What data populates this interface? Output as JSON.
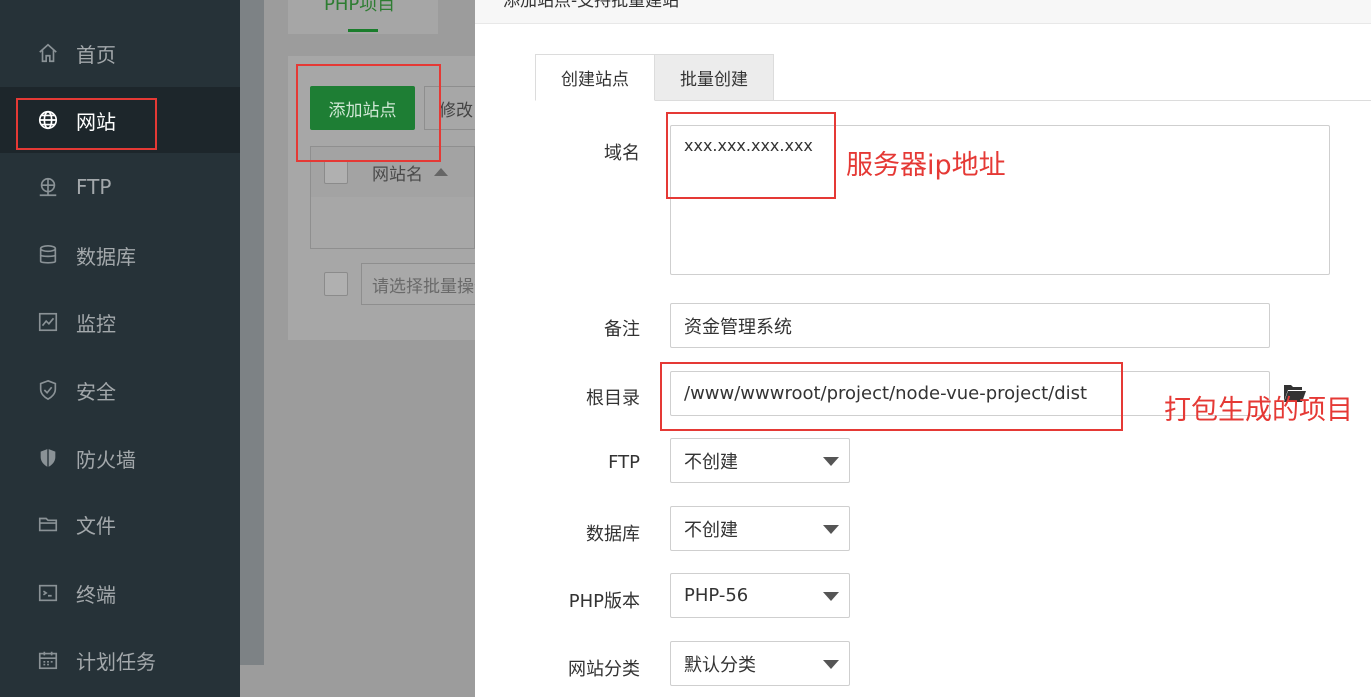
{
  "sidebar": {
    "items": [
      {
        "label": "首页",
        "icon": "home-icon"
      },
      {
        "label": "网站",
        "icon": "globe-icon",
        "active": true
      },
      {
        "label": "FTP",
        "icon": "ftp-icon"
      },
      {
        "label": "数据库",
        "icon": "database-icon"
      },
      {
        "label": "监控",
        "icon": "monitor-icon"
      },
      {
        "label": "安全",
        "icon": "shield-icon"
      },
      {
        "label": "防火墙",
        "icon": "firewall-icon"
      },
      {
        "label": "文件",
        "icon": "folder-icon"
      },
      {
        "label": "终端",
        "icon": "terminal-icon"
      },
      {
        "label": "计划任务",
        "icon": "calendar-icon"
      }
    ]
  },
  "background": {
    "tab_label": "PHP项目",
    "add_site_button": "添加站点",
    "modify_button": "修改",
    "table_column": "网站名",
    "batch_placeholder": "请选择批量操作"
  },
  "modal": {
    "title": "添加站点-支持批量建站",
    "tabs": [
      {
        "label": "创建站点",
        "active": true
      },
      {
        "label": "批量创建",
        "active": false
      }
    ],
    "fields": {
      "domain": {
        "label": "域名",
        "value": "xxx.xxx.xxx.xxx"
      },
      "remark": {
        "label": "备注",
        "value": "资金管理系统"
      },
      "root": {
        "label": "根目录",
        "value": "/www/wwwroot/project/node-vue-project/dist"
      },
      "ftp": {
        "label": "FTP",
        "value": "不创建"
      },
      "database": {
        "label": "数据库",
        "value": "不创建"
      },
      "php_version": {
        "label": "PHP版本",
        "value": "PHP-56"
      },
      "category": {
        "label": "网站分类",
        "value": "默认分类"
      }
    }
  },
  "annotations": {
    "server_ip": "服务器ip地址",
    "build_output": "打包生成的项目"
  },
  "colors": {
    "sidebar_bg": "#263238",
    "accent_green": "#20a53a",
    "annotation_red": "#e53935"
  }
}
